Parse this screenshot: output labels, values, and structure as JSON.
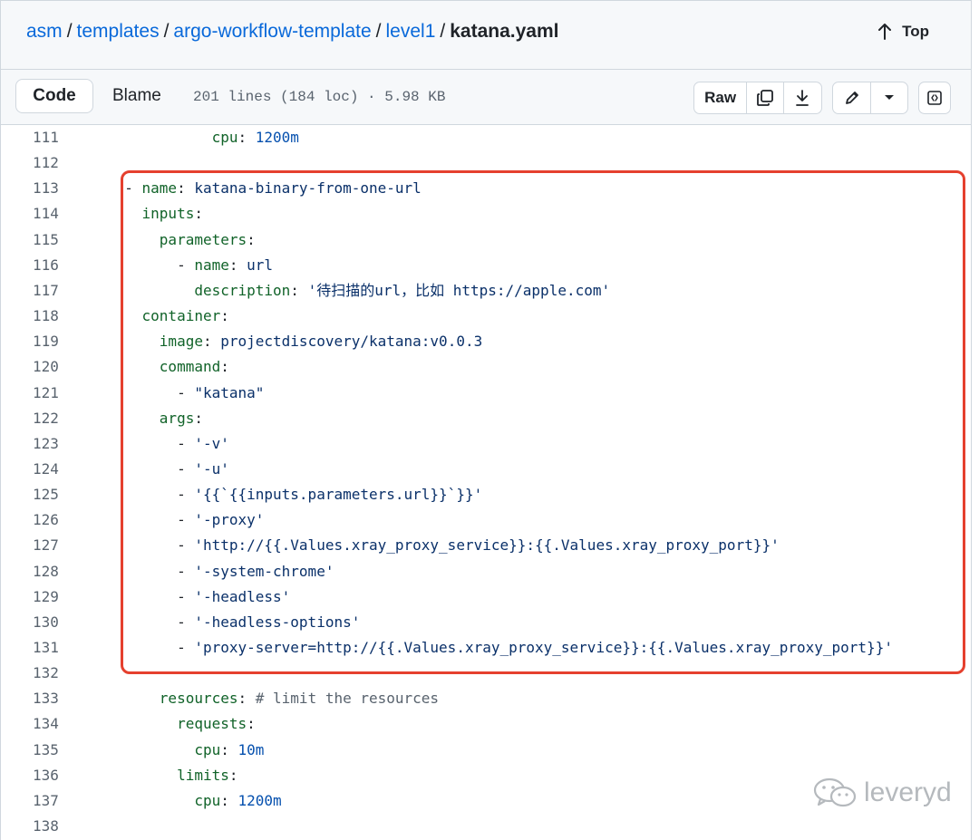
{
  "breadcrumb": {
    "parts": [
      "asm",
      "templates",
      "argo-workflow-template",
      "level1"
    ],
    "separator": "/",
    "current": "katana.yaml"
  },
  "top_button": {
    "label": "Top"
  },
  "toolbar": {
    "code_tab": "Code",
    "blame_tab": "Blame",
    "file_info": "201 lines (184 loc) · 5.98 KB",
    "raw_label": "Raw"
  },
  "icons": [
    "arrow-up-icon",
    "copy-icon",
    "download-icon",
    "pencil-icon",
    "chevron-down-icon",
    "symbols-icon",
    "wechat-icon"
  ],
  "colors": {
    "highlight_border": "#e5402e",
    "link": "#0969da",
    "key": "#116329",
    "string": "#0a3069",
    "number": "#0550ae"
  },
  "code": {
    "lines": [
      {
        "num": "111",
        "segs": [
          {
            "t": "            ",
            "c": "d"
          },
          {
            "t": "cpu",
            "c": "k"
          },
          {
            "t": ": ",
            "c": "d"
          },
          {
            "t": "1200m",
            "c": "n"
          }
        ]
      },
      {
        "num": "112",
        "segs": []
      },
      {
        "num": "113",
        "segs": [
          {
            "t": "  - ",
            "c": "d"
          },
          {
            "t": "name",
            "c": "k"
          },
          {
            "t": ": ",
            "c": "d"
          },
          {
            "t": "katana-binary-from-one-url",
            "c": "s"
          }
        ]
      },
      {
        "num": "114",
        "segs": [
          {
            "t": "    ",
            "c": "d"
          },
          {
            "t": "inputs",
            "c": "k"
          },
          {
            "t": ":",
            "c": "d"
          }
        ]
      },
      {
        "num": "115",
        "segs": [
          {
            "t": "      ",
            "c": "d"
          },
          {
            "t": "parameters",
            "c": "k"
          },
          {
            "t": ":",
            "c": "d"
          }
        ]
      },
      {
        "num": "116",
        "segs": [
          {
            "t": "        - ",
            "c": "d"
          },
          {
            "t": "name",
            "c": "k"
          },
          {
            "t": ": ",
            "c": "d"
          },
          {
            "t": "url",
            "c": "s"
          }
        ]
      },
      {
        "num": "117",
        "segs": [
          {
            "t": "          ",
            "c": "d"
          },
          {
            "t": "description",
            "c": "k"
          },
          {
            "t": ": ",
            "c": "d"
          },
          {
            "t": "'待扫描的url，比如 https://apple.com'",
            "c": "s"
          }
        ]
      },
      {
        "num": "118",
        "segs": [
          {
            "t": "    ",
            "c": "d"
          },
          {
            "t": "container",
            "c": "k"
          },
          {
            "t": ":",
            "c": "d"
          }
        ]
      },
      {
        "num": "119",
        "segs": [
          {
            "t": "      ",
            "c": "d"
          },
          {
            "t": "image",
            "c": "k"
          },
          {
            "t": ": ",
            "c": "d"
          },
          {
            "t": "projectdiscovery/katana:v0.0.3",
            "c": "s"
          }
        ]
      },
      {
        "num": "120",
        "segs": [
          {
            "t": "      ",
            "c": "d"
          },
          {
            "t": "command",
            "c": "k"
          },
          {
            "t": ":",
            "c": "d"
          }
        ]
      },
      {
        "num": "121",
        "segs": [
          {
            "t": "        - ",
            "c": "d"
          },
          {
            "t": "\"katana\"",
            "c": "s"
          }
        ]
      },
      {
        "num": "122",
        "segs": [
          {
            "t": "      ",
            "c": "d"
          },
          {
            "t": "args",
            "c": "k"
          },
          {
            "t": ":",
            "c": "d"
          }
        ]
      },
      {
        "num": "123",
        "segs": [
          {
            "t": "        - ",
            "c": "d"
          },
          {
            "t": "'-v'",
            "c": "s"
          }
        ]
      },
      {
        "num": "124",
        "segs": [
          {
            "t": "        - ",
            "c": "d"
          },
          {
            "t": "'-u'",
            "c": "s"
          }
        ]
      },
      {
        "num": "125",
        "segs": [
          {
            "t": "        - ",
            "c": "d"
          },
          {
            "t": "'{{`{{inputs.parameters.url}}`}}'",
            "c": "s"
          }
        ]
      },
      {
        "num": "126",
        "segs": [
          {
            "t": "        - ",
            "c": "d"
          },
          {
            "t": "'-proxy'",
            "c": "s"
          }
        ]
      },
      {
        "num": "127",
        "segs": [
          {
            "t": "        - ",
            "c": "d"
          },
          {
            "t": "'http://{{.Values.xray_proxy_service}}:{{.Values.xray_proxy_port}}'",
            "c": "s"
          }
        ]
      },
      {
        "num": "128",
        "segs": [
          {
            "t": "        - ",
            "c": "d"
          },
          {
            "t": "'-system-chrome'",
            "c": "s"
          }
        ]
      },
      {
        "num": "129",
        "segs": [
          {
            "t": "        - ",
            "c": "d"
          },
          {
            "t": "'-headless'",
            "c": "s"
          }
        ]
      },
      {
        "num": "130",
        "segs": [
          {
            "t": "        - ",
            "c": "d"
          },
          {
            "t": "'-headless-options'",
            "c": "s"
          }
        ]
      },
      {
        "num": "131",
        "segs": [
          {
            "t": "        - ",
            "c": "d"
          },
          {
            "t": "'proxy-server=http://{{.Values.xray_proxy_service}}:{{.Values.xray_proxy_port}}'",
            "c": "s"
          }
        ]
      },
      {
        "num": "132",
        "segs": []
      },
      {
        "num": "133",
        "segs": [
          {
            "t": "      ",
            "c": "d"
          },
          {
            "t": "resources",
            "c": "k"
          },
          {
            "t": ": ",
            "c": "d"
          },
          {
            "t": "# limit the resources",
            "c": "c"
          }
        ]
      },
      {
        "num": "134",
        "segs": [
          {
            "t": "        ",
            "c": "d"
          },
          {
            "t": "requests",
            "c": "k"
          },
          {
            "t": ":",
            "c": "d"
          }
        ]
      },
      {
        "num": "135",
        "segs": [
          {
            "t": "          ",
            "c": "d"
          },
          {
            "t": "cpu",
            "c": "k"
          },
          {
            "t": ": ",
            "c": "d"
          },
          {
            "t": "10m",
            "c": "n"
          }
        ]
      },
      {
        "num": "136",
        "segs": [
          {
            "t": "        ",
            "c": "d"
          },
          {
            "t": "limits",
            "c": "k"
          },
          {
            "t": ":",
            "c": "d"
          }
        ]
      },
      {
        "num": "137",
        "segs": [
          {
            "t": "          ",
            "c": "d"
          },
          {
            "t": "cpu",
            "c": "k"
          },
          {
            "t": ": ",
            "c": "d"
          },
          {
            "t": "1200m",
            "c": "n"
          }
        ]
      },
      {
        "num": "138",
        "segs": []
      }
    ]
  },
  "watermark": {
    "text": "leveryd"
  }
}
